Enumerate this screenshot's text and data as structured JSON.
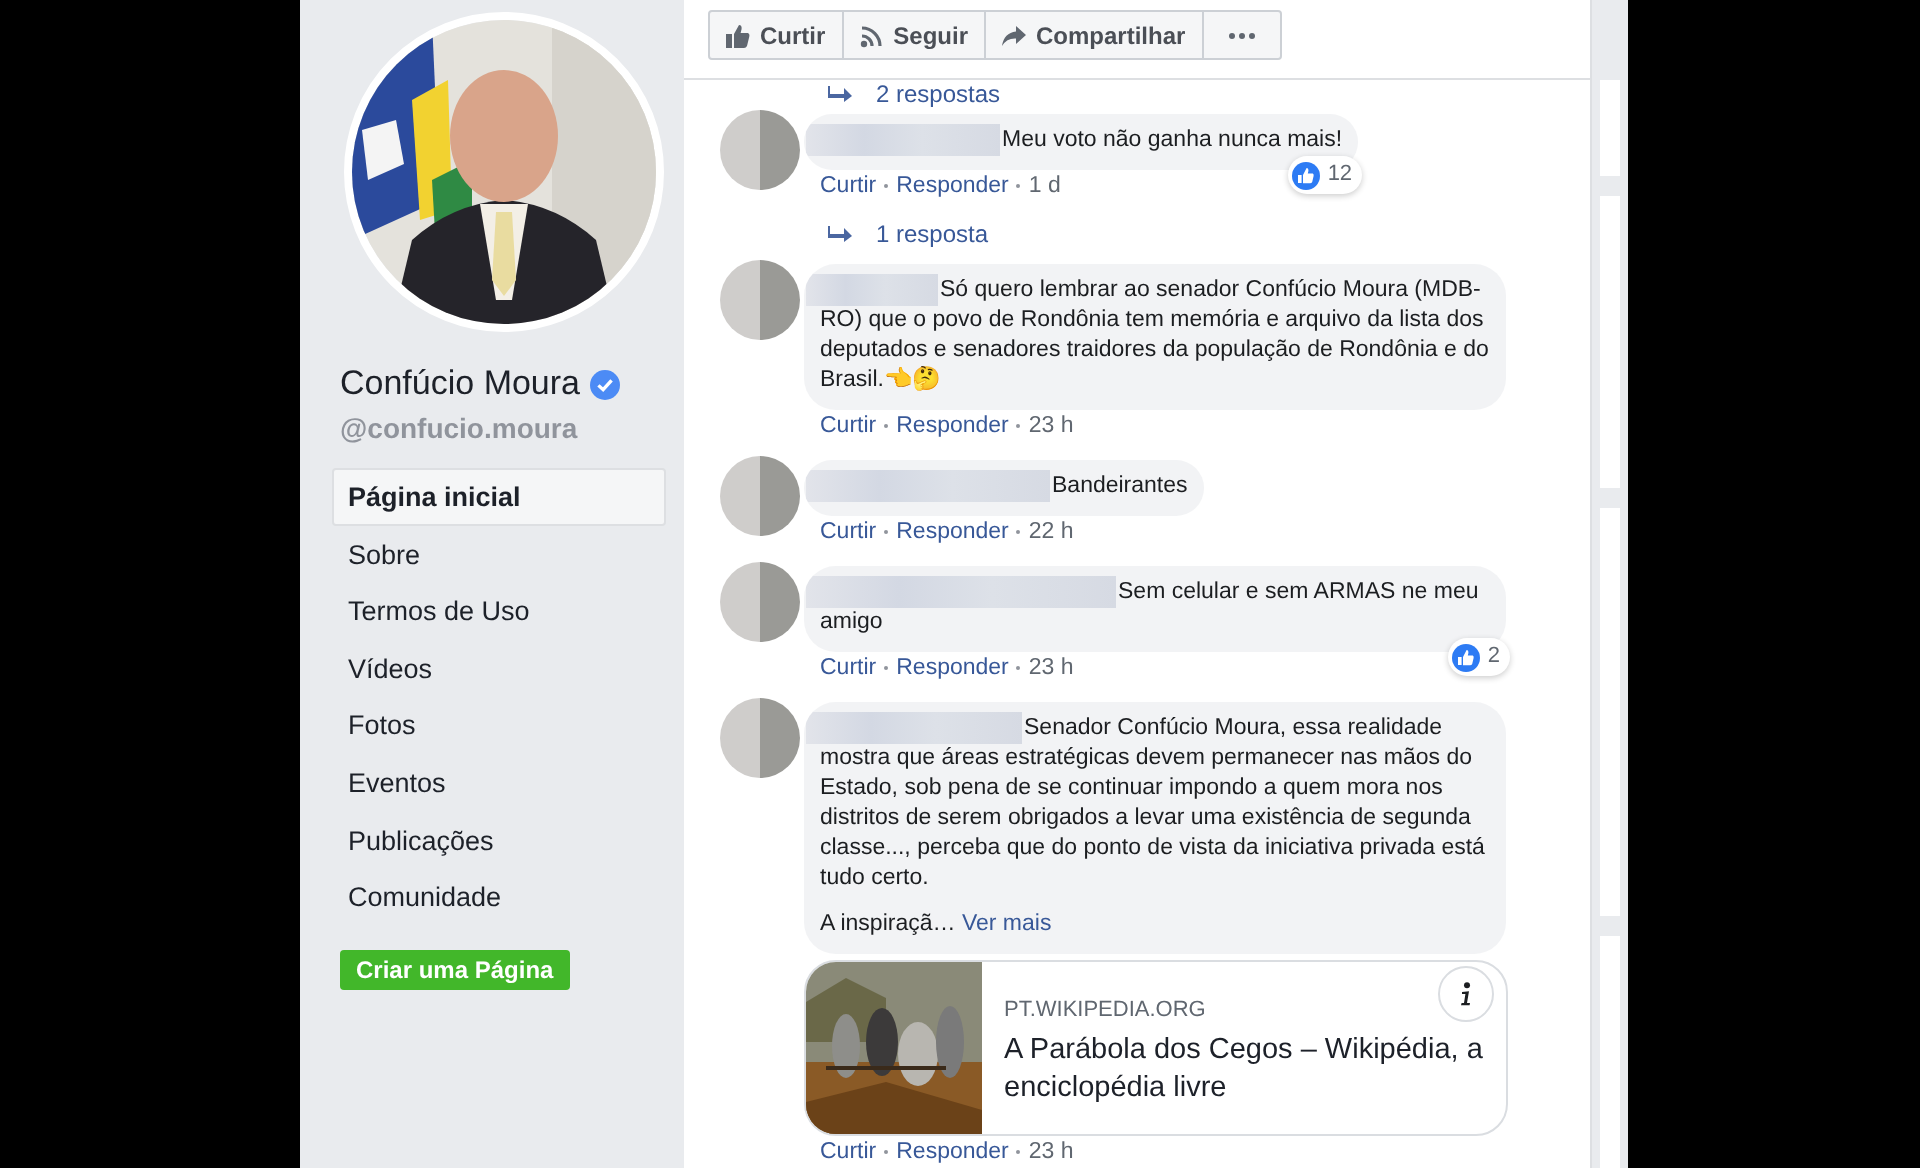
{
  "sidebar": {
    "name": "Confúcio Moura",
    "verified": true,
    "handle": "@confucio.moura",
    "nav": [
      {
        "label": "Página inicial",
        "selected": true
      },
      {
        "label": "Sobre",
        "selected": false
      },
      {
        "label": "Termos de Uso",
        "selected": false
      },
      {
        "label": "Vídeos",
        "selected": false
      },
      {
        "label": "Fotos",
        "selected": false
      },
      {
        "label": "Eventos",
        "selected": false
      },
      {
        "label": "Publicações",
        "selected": false
      },
      {
        "label": "Comunidade",
        "selected": false
      }
    ],
    "create_page_button": "Criar uma Página"
  },
  "toolbar": {
    "buttons": [
      {
        "kind": "like",
        "label": "Curtir"
      },
      {
        "kind": "follow",
        "label": "Seguir"
      },
      {
        "kind": "share",
        "label": "Compartilhar"
      },
      {
        "kind": "more"
      }
    ]
  },
  "top_replies_link": "2 respostas",
  "comments": [
    {
      "text": "Meu voto não ganha nunca mais!",
      "reactions": "12",
      "actions": [
        "Curtir",
        "Responder"
      ],
      "time": "1 d",
      "replies_link": "1 resposta"
    },
    {
      "text": "Só quero lembrar ao senador Confúcio Moura (MDB-RO) que o povo de Rondônia tem memória e arquivo da lista dos deputados e senadores traidores da população de Rondônia e do Brasil.👈🤔",
      "actions": [
        "Curtir",
        "Responder"
      ],
      "time": "23 h"
    },
    {
      "text": "Bandeirantes",
      "actions": [
        "Curtir",
        "Responder"
      ],
      "time": "22 h"
    },
    {
      "text": "Sem celular e sem ARMAS ne meu amigo",
      "reactions": "2",
      "actions": [
        "Curtir",
        "Responder"
      ],
      "time": "23 h"
    },
    {
      "text": "Senador Confúcio Moura, essa realidade mostra que áreas estratégicas devem permanecer nas mãos do Estado, sob pena de se continuar impondo a quem mora nos distritos de serem obrigados a levar uma existência de segunda classe..., perceba que do ponto de vista da iniciativa privada está tudo certo.",
      "excerpt": "A inspiraçã…",
      "more_link": "Ver mais",
      "link_preview": {
        "domain": "PT.WIKIPEDIA.ORG",
        "title": "A Parábola dos Cegos – Wikipédia, a enciclopédia livre"
      },
      "actions": [
        "Curtir",
        "Responder"
      ],
      "time": "23 h"
    }
  ]
}
